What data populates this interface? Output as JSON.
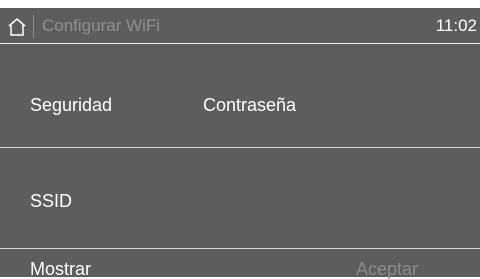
{
  "header": {
    "home_icon": "home-icon",
    "title": "Configurar WiFi",
    "time": "11:02"
  },
  "settings": {
    "security_label": "Seguridad",
    "security_value": "Contraseña",
    "ssid_label": "SSID"
  },
  "footer": {
    "show_label": "Mostrar",
    "accept_label": "Aceptar"
  },
  "colors": {
    "background": "#5d5d5d",
    "text": "#ffffff",
    "disabled_text": "#8b8b8b",
    "divider": "#d9d9d9"
  }
}
